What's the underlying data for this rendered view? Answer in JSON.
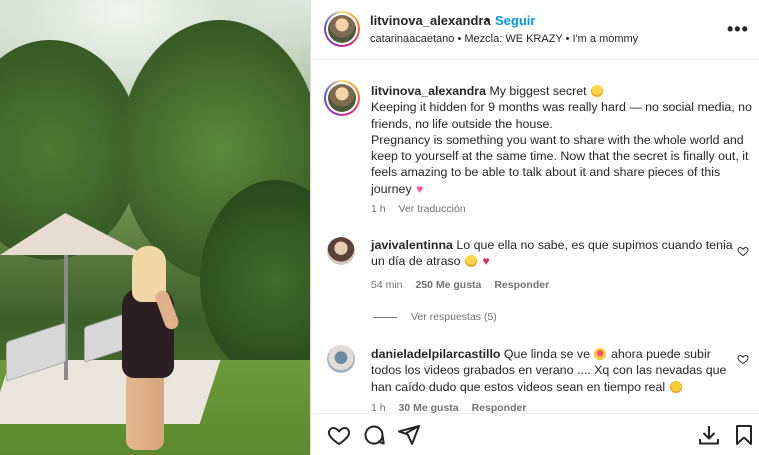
{
  "post": {
    "username": "litvinova_alexandra",
    "separator": "•",
    "follow_label": "Seguir",
    "subline": "catarinaacaetano • Mezcla: WE KRAZY • I'm a mommy",
    "more_label": "•••"
  },
  "caption": {
    "username": "litvinova_alexandra",
    "line1": "My biggest secret",
    "body": "Keeping it hidden for 9 months was really hard — no social media, no friends, no life outside the house.",
    "body2": "Pregnancy is something you want to share with the whole world and keep to yourself at the same time. Now that the secret is finally out, it feels amazing to be able to talk about it and share pieces of this journey",
    "time": "1 h",
    "translate_label": "Ver traducción"
  },
  "comments": [
    {
      "username": "javivalentinna",
      "text": "Lo que ella no sabe, es que supimos cuando tenia un día de atraso",
      "time": "54 min",
      "likes": "250 Me gusta",
      "reply_label": "Responder",
      "view_replies": "Ver respuestas (5)"
    },
    {
      "username": "danieladelpilarcastillo",
      "text_a": "Que linda se ve",
      "text_b": "ahora puede subir todos los videos grabados en verano .... Xq con las nevadas que han caído dudo que estos videos sean en tiempo real",
      "time": "1 h",
      "likes": "30 Me gusta",
      "reply_label": "Responder"
    }
  ],
  "icons": {
    "like": "heart-icon",
    "comment": "comment-icon",
    "share": "send-icon",
    "download": "download-icon",
    "save": "bookmark-icon"
  },
  "colors": {
    "follow": "#0095f6",
    "meta": "#737373",
    "text": "#262626"
  }
}
